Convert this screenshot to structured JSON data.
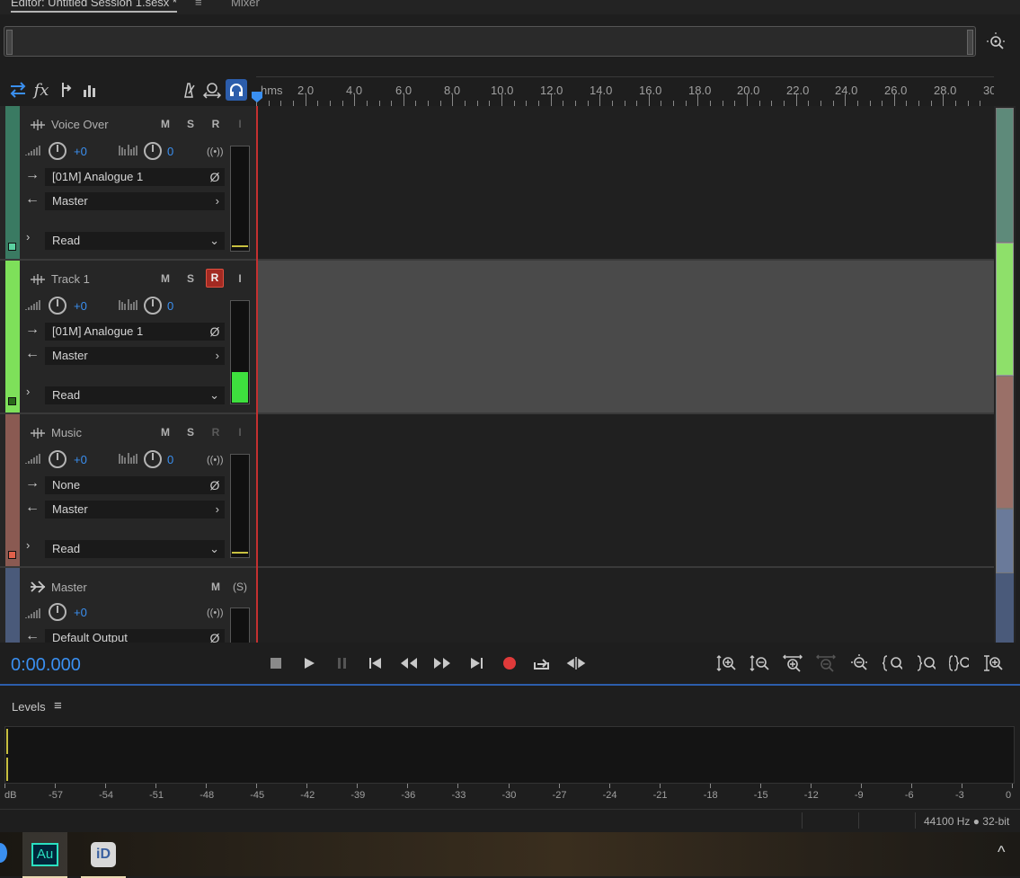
{
  "tabs": {
    "editor_label": "Editor: Untitled Session 1.sesx *",
    "menu_glyph": "≡",
    "mixer_label": "Mixer"
  },
  "toolbar": {
    "icons": [
      "routing-icon",
      "fx-icon",
      "sends-icon",
      "eq-icon",
      "metronome-icon",
      "input-monitor-icon",
      "headphones-icon"
    ],
    "accent_color": "#3a8ff0"
  },
  "ruler": {
    "unit_label": "hms",
    "ticks": [
      "2.0",
      "4.0",
      "6.0",
      "8.0",
      "10.0",
      "12.0",
      "14.0",
      "16.0",
      "18.0",
      "20.0",
      "22.0",
      "24.0",
      "26.0",
      "28.0",
      "30"
    ]
  },
  "tracks": [
    {
      "name": "Voice Over",
      "color": "#3a7a62",
      "mute": "M",
      "solo": "S",
      "record": "R",
      "input_monitor": "I",
      "volume": "+0",
      "pan": "0",
      "input": "[01M] Analogue 1",
      "output": "Master",
      "automation": "Read",
      "record_armed": false,
      "meter_level": 0.0
    },
    {
      "name": "Track 1",
      "color": "#7ee05a",
      "mute": "M",
      "solo": "S",
      "record": "R",
      "input_monitor": "I",
      "volume": "+0",
      "pan": "0",
      "input": "[01M] Analogue 1",
      "output": "Master",
      "automation": "Read",
      "record_armed": true,
      "meter_level": 0.3
    },
    {
      "name": "Music",
      "color": "#8a5a52",
      "mute": "M",
      "solo": "S",
      "record": "R",
      "input_monitor": "I",
      "volume": "+0",
      "pan": "0",
      "input": "None",
      "output": "Master",
      "automation": "Read",
      "record_armed": false,
      "meter_level": 0.0
    }
  ],
  "master": {
    "name": "Master",
    "color": "#4a5a7a",
    "mute": "M",
    "solo": "(S)",
    "volume": "+0",
    "output": "Default Output"
  },
  "transport": {
    "time": "0:00.000",
    "buttons": [
      "stop",
      "play",
      "pause",
      "move-to-previous",
      "rewind",
      "fast-forward",
      "move-to-next",
      "record",
      "play-loop",
      "skip-selection"
    ],
    "zoom_buttons": [
      "zoom-in-amplitude",
      "zoom-out-amplitude",
      "zoom-in-time",
      "zoom-out-time-disabled",
      "zoom-out-full",
      "zoom-in-at-start",
      "zoom-in-at-end",
      "zoom-to-selection",
      "zoom-in-tracks"
    ],
    "record_color": "#e03a3a"
  },
  "levels": {
    "title": "Levels",
    "menu_glyph": "≡",
    "scale": [
      "dB",
      "-57",
      "-54",
      "-51",
      "-48",
      "-45",
      "-42",
      "-39",
      "-36",
      "-33",
      "-30",
      "-27",
      "-24",
      "-21",
      "-18",
      "-15",
      "-12",
      "-9",
      "-6",
      "-3",
      "0"
    ]
  },
  "status": {
    "text": "44100 Hz ● 32-bit"
  },
  "taskbar": {
    "apps": [
      {
        "name": "Au",
        "active": true,
        "color": "#2a9a8a"
      },
      {
        "name": "iD",
        "active": false,
        "color": "#d8d8d8"
      }
    ],
    "tray_glyph": "^"
  }
}
